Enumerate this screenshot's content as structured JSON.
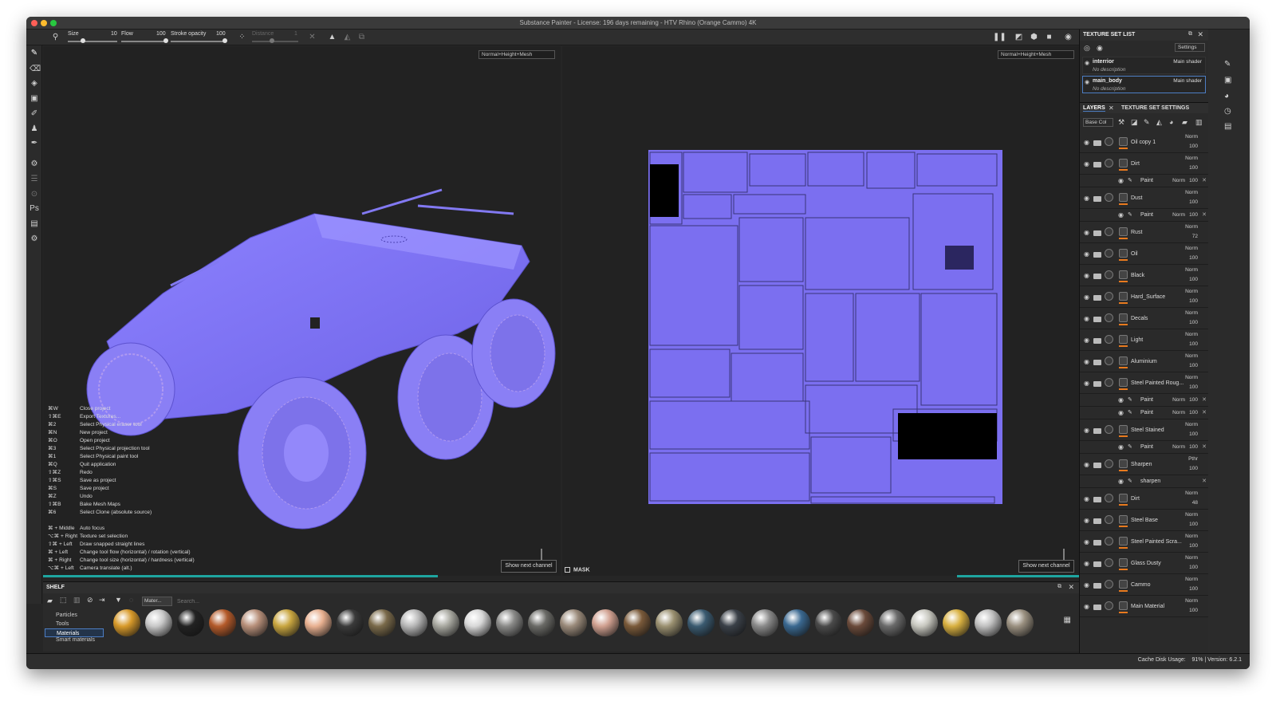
{
  "window": {
    "title": "Substance Painter - License: 196 days remaining - HTV Rhino (Orange Cammo) 4K"
  },
  "toolbar": {
    "size_label": "Size",
    "size_value": "10",
    "flow_label": "Flow",
    "flow_value": "100",
    "stroke_label": "Stroke opacity",
    "stroke_value": "100",
    "distance_label": "Distance",
    "distance_value": "1"
  },
  "viewport": {
    "channel_left": "Normal+Height+Mesh",
    "channel_right": "Normal+Height+Mesh",
    "show_next_channel": "Show next channel",
    "mask_label": "MASK"
  },
  "shortcuts": [
    {
      "key": "⌘W",
      "action": "Close project"
    },
    {
      "key": "⇧⌘E",
      "action": "Export Textures..."
    },
    {
      "key": "⌘2",
      "action": "Select Physical eraser tool"
    },
    {
      "key": "⌘N",
      "action": "New project"
    },
    {
      "key": "⌘O",
      "action": "Open project"
    },
    {
      "key": "⌘3",
      "action": "Select Physical projection tool"
    },
    {
      "key": "⌘1",
      "action": "Select Physical paint tool"
    },
    {
      "key": "⌘Q",
      "action": "Quit application"
    },
    {
      "key": "⇧⌘Z",
      "action": "Redo"
    },
    {
      "key": "⇧⌘S",
      "action": "Save as project"
    },
    {
      "key": "⌘S",
      "action": "Save project"
    },
    {
      "key": "⌘Z",
      "action": "Undo"
    },
    {
      "key": "⇧⌘B",
      "action": "Bake Mesh Maps"
    },
    {
      "key": "⌘6",
      "action": "Select Clone (absolute source)"
    }
  ],
  "shortcuts2": [
    {
      "key": "⌘ + Middle",
      "action": "Auto focus"
    },
    {
      "key": "⌥⌘ + Right",
      "action": "Texture set selection"
    },
    {
      "key": "⇧⌘ + Left",
      "action": "Draw snapped straight lines"
    },
    {
      "key": "⌘ + Left",
      "action": "Change tool flow (horizontal) / rotation (vertical)"
    },
    {
      "key": "⌘ + Right",
      "action": "Change tool size (horizontal) / hardness (vertical)"
    },
    {
      "key": "⌥⌘ + Left",
      "action": "Camera translate (alt.)"
    }
  ],
  "shelf": {
    "title": "SHELF",
    "filter": "Mater...",
    "search_placeholder": "Search...",
    "categories": [
      "Particles",
      "Tools",
      "Materials",
      "Smart materials"
    ]
  },
  "texture_set_list": {
    "title": "TEXTURE SET LIST",
    "settings": "Settings",
    "items": [
      {
        "name": "interrior",
        "desc": "No description",
        "shader": "Main shader"
      },
      {
        "name": "main_body",
        "desc": "No description",
        "shader": "Main shader"
      }
    ]
  },
  "layers_panel": {
    "tab_layers": "LAYERS",
    "tab_settings": "TEXTURE SET SETTINGS",
    "channel": "Base Col"
  },
  "layers": [
    {
      "name": "Oil copy 1",
      "blend": "Norm",
      "opacity": "100"
    },
    {
      "name": "Dirt",
      "blend": "Norm",
      "opacity": "100",
      "sub": [
        {
          "name": "Paint",
          "blend": "Norm",
          "opacity": "100"
        }
      ]
    },
    {
      "name": "Dust",
      "blend": "Norm",
      "opacity": "100",
      "sub": [
        {
          "name": "Paint",
          "blend": "Norm",
          "opacity": "100"
        }
      ]
    },
    {
      "name": "Rust",
      "blend": "Norm",
      "opacity": "72"
    },
    {
      "name": "Oil",
      "blend": "Norm",
      "opacity": "100"
    },
    {
      "name": "Black",
      "blend": "Norm",
      "opacity": "100"
    },
    {
      "name": "Hard_Surface",
      "blend": "Norm",
      "opacity": "100"
    },
    {
      "name": "Decals",
      "blend": "Norm",
      "opacity": "100"
    },
    {
      "name": "Light",
      "blend": "Norm",
      "opacity": "100"
    },
    {
      "name": "Aluminium",
      "blend": "Norm",
      "opacity": "100"
    },
    {
      "name": "Steel Painted Roug...",
      "blend": "Norm",
      "opacity": "100",
      "sub": [
        {
          "name": "Paint",
          "blend": "Norm",
          "opacity": "100"
        },
        {
          "name": "Paint",
          "blend": "Norm",
          "opacity": "100"
        }
      ]
    },
    {
      "name": "Steel Stained",
      "blend": "Norm",
      "opacity": "100",
      "sub": [
        {
          "name": "Paint",
          "blend": "Norm",
          "opacity": "100"
        }
      ]
    },
    {
      "name": "Sharpen",
      "blend": "Pthr",
      "opacity": "100",
      "sub": [
        {
          "name": "sharpen",
          "blend": "",
          "opacity": ""
        }
      ]
    },
    {
      "name": "Dirt",
      "blend": "Norm",
      "opacity": "48"
    },
    {
      "name": "Steel Base",
      "blend": "Norm",
      "opacity": "100"
    },
    {
      "name": "Steel Painted Scra...",
      "blend": "Norm",
      "opacity": "100"
    },
    {
      "name": "Glass Dusty",
      "blend": "Norm",
      "opacity": "100"
    },
    {
      "name": "Cammo",
      "blend": "Norm",
      "opacity": "100"
    },
    {
      "name": "Main Material",
      "blend": "Norm",
      "opacity": "100"
    }
  ],
  "status": {
    "cache": "Cache Disk Usage:",
    "cache_value": "91% | Version: 6.2.1"
  },
  "colors": {
    "accent": "#1ea5a0",
    "normal_map": "#7b6ff0",
    "selection": "#4d7ec4",
    "orange": "#e87a1e"
  }
}
